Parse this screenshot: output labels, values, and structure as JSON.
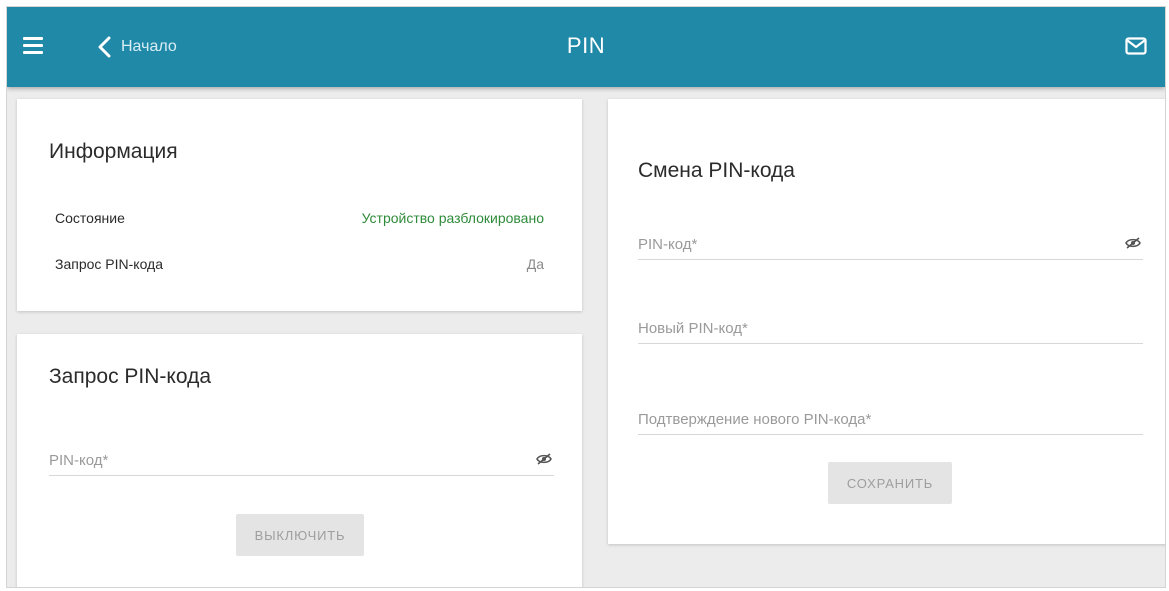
{
  "header": {
    "back_label": "Начало",
    "title": "PIN",
    "accent_color": "#2089a8"
  },
  "info_card": {
    "title": "Информация",
    "rows": [
      {
        "key": "Состояние",
        "value": "Устройство разблокировано",
        "value_color": "#2e8b3a"
      },
      {
        "key": "Запрос PIN-кода",
        "value": "Да",
        "value_color": "#8a8a8a"
      }
    ]
  },
  "pin_request_card": {
    "title": "Запрос PIN-кода",
    "pin_field": {
      "placeholder": "PIN-код",
      "required": "*"
    },
    "button_label": "ВЫКЛЮЧИТЬ"
  },
  "change_pin_card": {
    "title": "Смена PIN-кода",
    "fields": [
      {
        "placeholder": "PIN-код",
        "required": "*"
      },
      {
        "placeholder": "Новый PIN-код",
        "required": "*"
      },
      {
        "placeholder": "Подтверждение нового PIN-кода",
        "required": "*"
      }
    ],
    "button_label": "СОХРАНИТЬ"
  },
  "icons": {
    "menu": "menu-icon",
    "back": "chevron-left-icon",
    "mail": "mail-icon",
    "eye": "eye-off-icon"
  }
}
